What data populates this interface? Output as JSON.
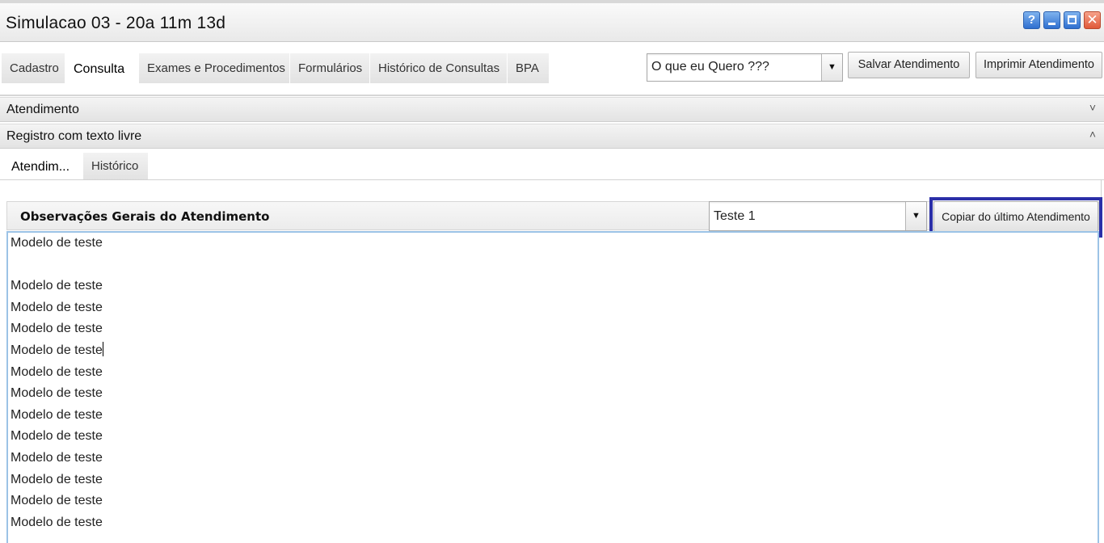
{
  "window": {
    "title": "Simulacao 03 - 20a 11m 13d",
    "buttons": [
      {
        "icon": "help-icon",
        "label": "?"
      },
      {
        "icon": "minimize-icon"
      },
      {
        "icon": "maximize-icon"
      },
      {
        "icon": "close-icon"
      }
    ]
  },
  "main_tabs": [
    {
      "label": "Cadastro",
      "active": false
    },
    {
      "label": "Consulta",
      "active": true
    },
    {
      "label": "Exames e Procedimentos",
      "active": false
    },
    {
      "label": "Formulários",
      "active": false
    },
    {
      "label": "Histórico de Consultas",
      "active": false
    },
    {
      "label": "BPA",
      "active": false
    }
  ],
  "toolbar": {
    "what_i_want_value": "O que eu Quero ???",
    "save_label": "Salvar Atendimento",
    "print_label": "Imprimir Atendimento"
  },
  "sections": {
    "atendimento": {
      "label": "Atendimento",
      "chevron": "˅"
    },
    "registro": {
      "label": "Registro com texto livre",
      "chevron": "˄"
    }
  },
  "sub_tabs": [
    {
      "label": "Atendim...",
      "active": true
    },
    {
      "label": "Histórico",
      "active": false
    }
  ],
  "observacoes": {
    "title": "Observações Gerais do Atendimento",
    "template_value": "Teste 1",
    "copy_button_label": "Copiar do último Atendimento",
    "highlight_color": "#2b2fa8",
    "lines": [
      "Modelo de teste",
      "",
      "Modelo de teste",
      "Modelo de teste",
      "Modelo de teste",
      "Modelo de teste",
      "Modelo de teste",
      "Modelo de teste",
      "Modelo de teste",
      "Modelo de teste",
      "Modelo de teste",
      "Modelo de teste",
      "Modelo de teste",
      "Modelo de teste"
    ]
  }
}
